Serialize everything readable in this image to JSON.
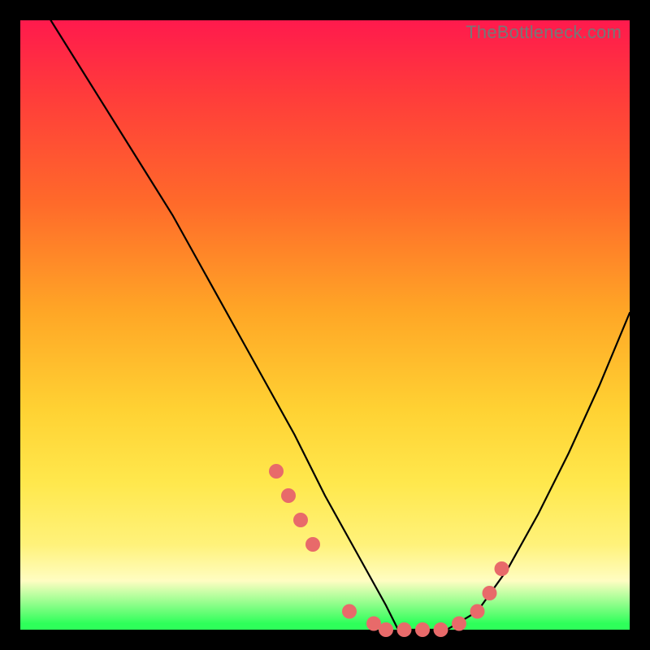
{
  "watermark": "TheBottleneck.com",
  "chart_data": {
    "type": "line",
    "title": "",
    "xlabel": "",
    "ylabel": "",
    "xlim": [
      0,
      100
    ],
    "ylim": [
      0,
      100
    ],
    "series": [
      {
        "name": "bottleneck-curve",
        "x": [
          5,
          10,
          15,
          20,
          25,
          30,
          35,
          40,
          45,
          50,
          55,
          60,
          62,
          65,
          70,
          75,
          80,
          85,
          90,
          95,
          100
        ],
        "values": [
          100,
          92,
          84,
          76,
          68,
          59,
          50,
          41,
          32,
          22,
          13,
          4,
          0,
          0,
          0,
          3,
          10,
          19,
          29,
          40,
          52
        ]
      }
    ],
    "markers": {
      "name": "highlight-dots",
      "color": "#e86a6a",
      "x": [
        42,
        44,
        46,
        48,
        54,
        58,
        60,
        63,
        66,
        69,
        72,
        75,
        77,
        79
      ],
      "values": [
        26,
        22,
        18,
        14,
        3,
        1,
        0,
        0,
        0,
        0,
        1,
        3,
        6,
        10
      ]
    },
    "gradient_stops": [
      {
        "pos": 0.0,
        "color": "#ff1a4d"
      },
      {
        "pos": 0.3,
        "color": "#ff6a2a"
      },
      {
        "pos": 0.64,
        "color": "#ffd233"
      },
      {
        "pos": 0.92,
        "color": "#fffdc2"
      },
      {
        "pos": 1.0,
        "color": "#2eff5a"
      }
    ]
  }
}
